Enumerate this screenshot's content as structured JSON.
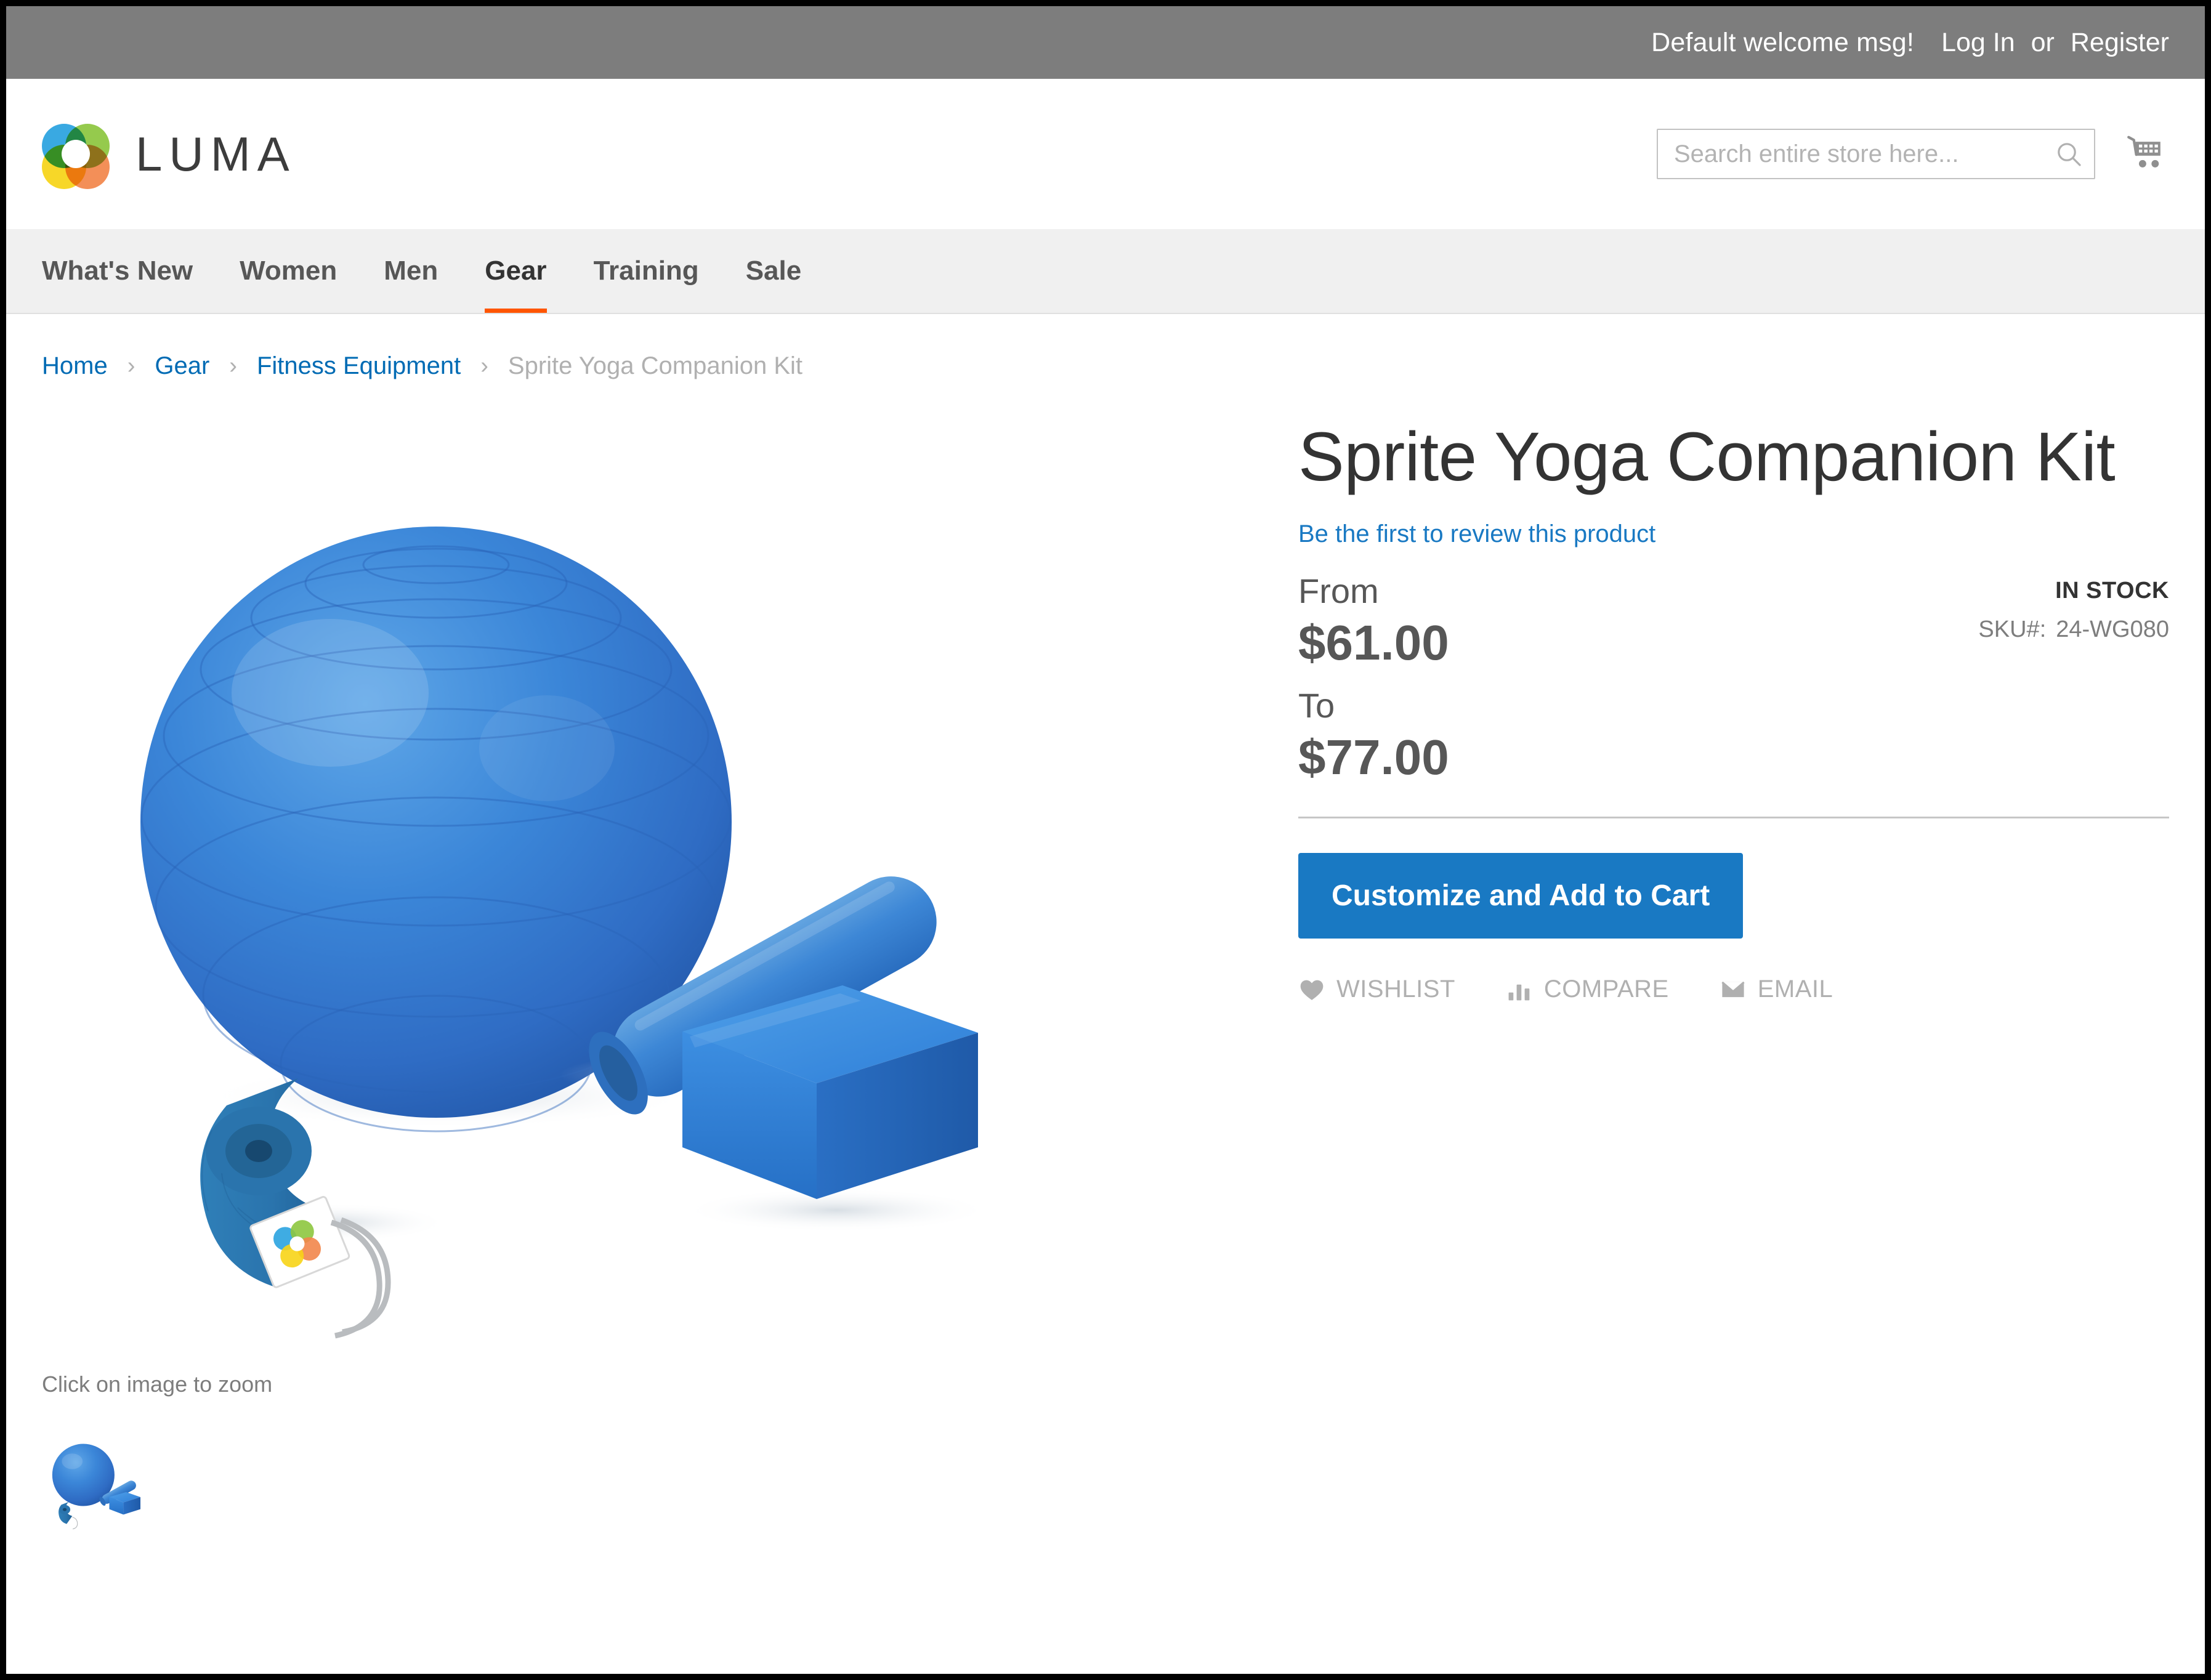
{
  "top_bar": {
    "welcome_message": "Default welcome msg!",
    "login_label": "Log In",
    "separator": "or",
    "register_label": "Register"
  },
  "header": {
    "logo_text": "LUMA",
    "logo_icon": "luma-flower-logo",
    "search": {
      "placeholder": "Search entire store here...",
      "value": "",
      "icon": "search-icon"
    },
    "cart_icon": "shopping-cart-icon"
  },
  "nav": {
    "items": [
      {
        "label": "What's New",
        "active": false
      },
      {
        "label": "Women",
        "active": false
      },
      {
        "label": "Men",
        "active": false
      },
      {
        "label": "Gear",
        "active": true
      },
      {
        "label": "Training",
        "active": false
      },
      {
        "label": "Sale",
        "active": false
      }
    ],
    "active_underline_color": "#ff5501"
  },
  "breadcrumbs": {
    "separator": "›",
    "items": [
      {
        "label": "Home",
        "current": false
      },
      {
        "label": "Gear",
        "current": false
      },
      {
        "label": "Fitness Equipment",
        "current": false
      },
      {
        "label": "Sprite Yoga Companion Kit",
        "current": true
      }
    ]
  },
  "gallery": {
    "zoom_note": "Click on image to zoom",
    "main_image_alt": "Sprite Yoga Companion Kit - blue exercise ball, foam roller, yoga strap and foam block",
    "thumbnail_alt": "Sprite Yoga Companion Kit thumbnail"
  },
  "product": {
    "title": "Sprite Yoga Companion Kit",
    "review_link": "Be the first to review this product",
    "stock_status": "IN STOCK",
    "sku_label": "SKU#:",
    "sku_value": "24-WG080",
    "price": {
      "from_label": "From",
      "from_value": "$61.00",
      "to_label": "To",
      "to_value": "$77.00"
    },
    "add_to_cart_label": "Customize and Add to Cart",
    "social": [
      {
        "label": "WISHLIST",
        "icon": "heart-icon"
      },
      {
        "label": "COMPARE",
        "icon": "bar-chart-icon"
      },
      {
        "label": "EMAIL",
        "icon": "envelope-icon"
      }
    ]
  },
  "colors": {
    "top_bar_bg": "#7d7d7d",
    "nav_bg": "#f0f0f0",
    "accent_orange": "#ff5501",
    "link_blue": "#1979c3",
    "button_blue": "#1979c3",
    "muted_gray": "#b0b0b0"
  }
}
